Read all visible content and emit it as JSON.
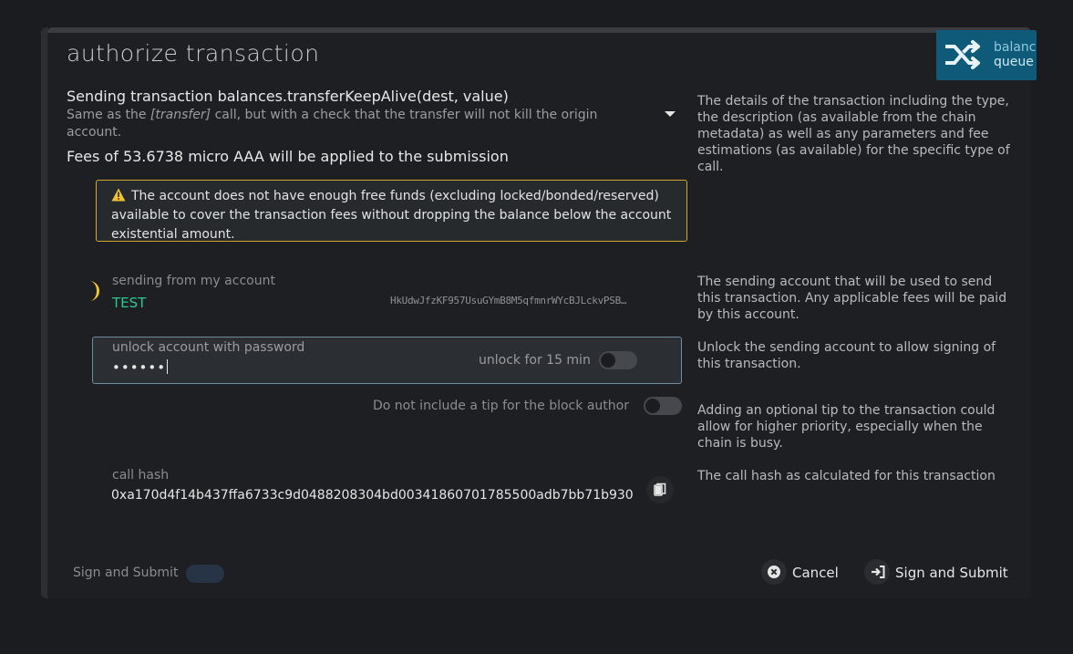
{
  "modal": {
    "title": "authorize transaction",
    "queue_button": {
      "line1": "balanc",
      "line2": "queue",
      "color": "#0f5a78"
    }
  },
  "transaction": {
    "sending": "Sending transaction balances.transferKeepAlive(dest, value)",
    "description_pre": "Same as the ",
    "description_em": "[transfer]",
    "description_post": " call, but with a check that the transfer will not kill the origin account.",
    "fees": "Fees of 53.6738 micro AAA will be applied to the submission",
    "help": "The details of the transaction including the type, the description (as available from the chain metadata) as well as any parameters and fee estimations (as available) for the specific type of call."
  },
  "warning": {
    "text": "The account does not have enough free funds (excluding locked/bonded/reserved) available to cover the transaction fees without dropping the balance below the account existential amount.",
    "color": "#d4a72c"
  },
  "account": {
    "label": "sending from my account",
    "name": "TEST",
    "address": "HkUdwJfzKF957UsuGYmB8M5qfmnrWYcBJLckvPSB…",
    "help": "The sending account that will be used to send this transaction. Any applicable fees will be paid by this account."
  },
  "unlock": {
    "label": "unlock account with password",
    "value": "••••••",
    "unlock_for": "unlock for 15 min",
    "help": "Unlock the sending account to allow signing of this transaction."
  },
  "tip": {
    "label": "Do not include a tip for the block author",
    "help": "Adding an optional tip to the transaction could allow for higher priority, especially when the chain is busy."
  },
  "call_hash": {
    "label": "call hash",
    "value": "0xa170d4f14b437ffa6733c9d0488208304bd00341860701785500adb7bb71b930",
    "help": "The call hash as calculated for this transaction"
  },
  "footer": {
    "toggle_label": "Sign and Submit",
    "cancel": "Cancel",
    "submit": "Sign and Submit"
  }
}
